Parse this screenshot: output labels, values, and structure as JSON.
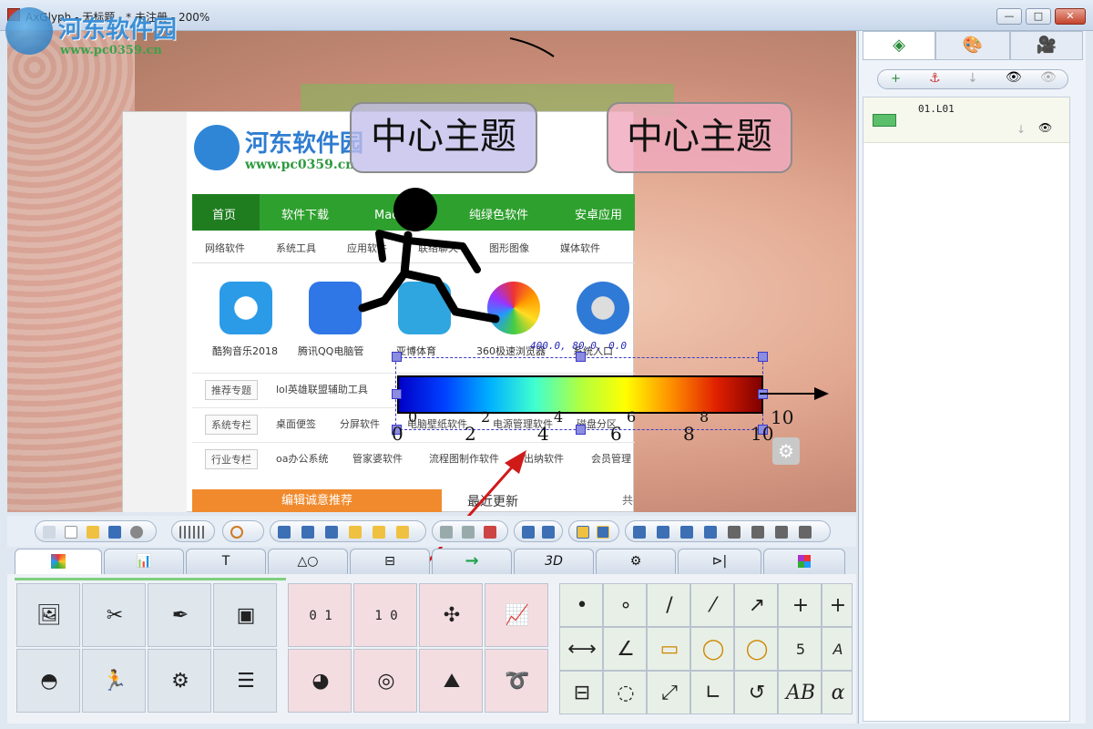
{
  "window": {
    "title": "AxGlyph - 无标题 - * 未注册 - 200%",
    "controls": {
      "minimize": "—",
      "maximize": "□",
      "close": "✕"
    }
  },
  "watermark": {
    "site_name": "河东软件园",
    "url": "www.pc0359.cn"
  },
  "canvas": {
    "topics": [
      "中心主题",
      "中心主题"
    ],
    "colorbar": {
      "coord_readout": "400.0, 80.0, 0.0",
      "lower_ticks": [
        "0",
        "2",
        "4",
        "6",
        "8",
        "10"
      ],
      "upper_ticks": [
        "0",
        "2",
        "4",
        "6",
        "8",
        "10"
      ]
    },
    "embedded_page": {
      "logo_text": "河东软件园",
      "logo_url": "www.pc0359.cn",
      "nav": [
        "首页",
        "软件下载",
        "Mac软件",
        "纯绿色软件",
        "安卓应用"
      ],
      "subnav": [
        "网络软件",
        "系统工具",
        "应用软件",
        "联络聊天",
        "图形图像",
        "媒体软件"
      ],
      "apps": [
        "酷狗音乐2018",
        "腾讯QQ电脑管",
        "亚博体育",
        "360极速浏览器",
        "系统入口"
      ],
      "rows": [
        {
          "tag": "推荐专题",
          "items": [
            "lol英雄联盟辅助工具"
          ]
        },
        {
          "tag": "系统专栏",
          "items": [
            "桌面便签",
            "分屏软件",
            "电脑壁纸软件",
            "电源管理软件",
            "磁盘分区"
          ]
        },
        {
          "tag": "行业专栏",
          "items": [
            "oa办公系统",
            "管家婆软件",
            "流程图制作软件",
            "出纳软件",
            "会员管理"
          ]
        }
      ],
      "orange_bar": "编辑诚意推荐",
      "latest": "最近更新",
      "more": "共"
    }
  },
  "toolbar": {
    "groups": [
      "file",
      "grid",
      "rotate",
      "align",
      "size",
      "flip",
      "group",
      "distribute"
    ]
  },
  "tabs": [
    {
      "label": "",
      "icon": "palette-grid-icon"
    },
    {
      "label": "",
      "icon": "chart-icon"
    },
    {
      "label": "T",
      "icon": "text-icon"
    },
    {
      "label": "△○",
      "icon": "shapes-icon"
    },
    {
      "label": "",
      "icon": "flowchart-icon"
    },
    {
      "label": "→",
      "icon": "arrow-icon"
    },
    {
      "label": "3D",
      "icon": "3d-icon"
    },
    {
      "label": "",
      "icon": "gear-icon"
    },
    {
      "label": "",
      "icon": "circuit-icon"
    },
    {
      "label": "",
      "icon": "grid-icon"
    }
  ],
  "panels": {
    "left_tiles": [
      "image-icon",
      "scissors-icon",
      "pen-icon",
      "box-icon",
      "roll-icon",
      "runner-icon",
      "head-gear-icon",
      "tree-icon"
    ],
    "middle_tiles": [
      {
        "icon": "ruler-icon",
        "label": "0 1"
      },
      {
        "icon": "colorbar-icon",
        "label": "1 0"
      },
      {
        "icon": "axis-3d-icon",
        "label": ""
      },
      {
        "icon": "plot-icon",
        "label": ""
      },
      {
        "icon": "pie-icon",
        "label": ""
      },
      {
        "icon": "radar-icon",
        "label": ""
      },
      {
        "icon": "surface-icon",
        "label": ""
      },
      {
        "icon": "helix-icon",
        "label": ""
      }
    ],
    "right_tiles": [
      {
        "icon": "dot-icon",
        "label": "•"
      },
      {
        "icon": "small-circle-icon",
        "label": "∘"
      },
      {
        "icon": "line-icon",
        "label": "/"
      },
      {
        "icon": "dashed-line-icon",
        "label": "⁄"
      },
      {
        "icon": "arrow-up-right-icon",
        "label": "↗"
      },
      {
        "icon": "crosshair-icon",
        "label": "+"
      },
      {
        "icon": "cross-partial-icon",
        "label": "+"
      },
      {
        "icon": "dimension-icon",
        "label": "⟷"
      },
      {
        "icon": "angle-icon",
        "label": "∠"
      },
      {
        "icon": "callout-rect-icon",
        "label": "▭"
      },
      {
        "icon": "callout-round-icon",
        "label": "◯"
      },
      {
        "icon": "callout-oval-icon",
        "label": "◯"
      },
      {
        "icon": "number-badge-icon",
        "label": "5"
      },
      {
        "icon": "letter-badge-icon",
        "label": "A"
      },
      {
        "icon": "split-box-icon",
        "label": "⊟"
      },
      {
        "icon": "dashed-circle-icon",
        "label": "◌"
      },
      {
        "icon": "double-arrow-icon",
        "label": "⤢"
      },
      {
        "icon": "corner-icon",
        "label": "∟"
      },
      {
        "icon": "rotate-icon",
        "label": "↺"
      },
      {
        "icon": "text-ab-icon",
        "label": "AB"
      },
      {
        "icon": "text-alpha-icon",
        "label": "α"
      }
    ]
  },
  "right_panel": {
    "tabs": [
      "layers-icon",
      "palette-icon",
      "camera-icon"
    ],
    "layer": {
      "name": "01.L01"
    }
  }
}
